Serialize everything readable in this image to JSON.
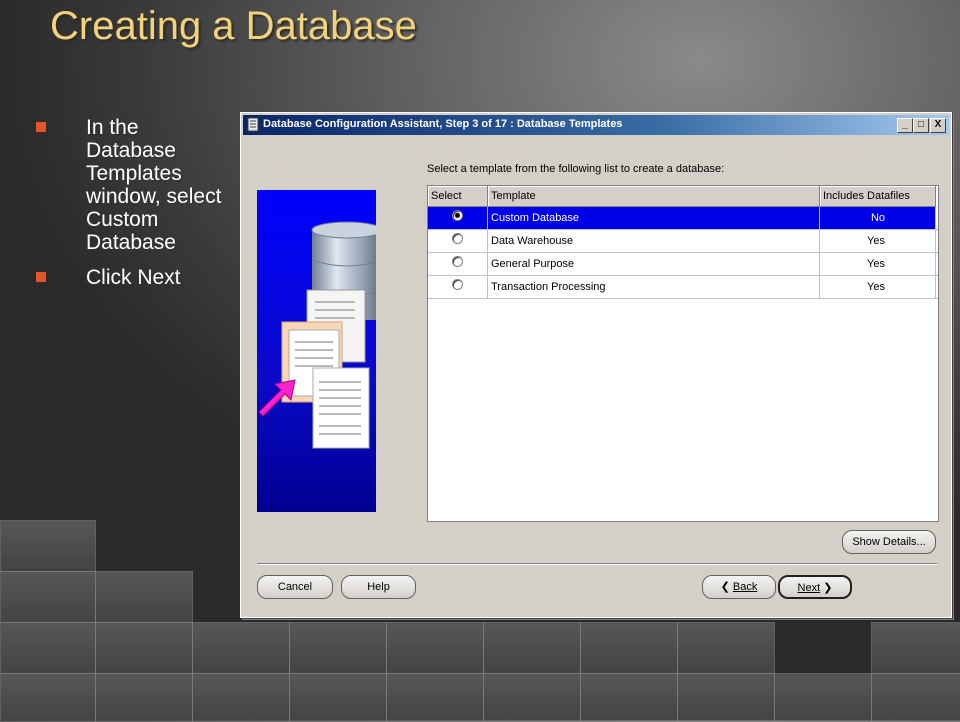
{
  "slide": {
    "title": "Creating a Database",
    "bullets": [
      "In the Database Templates window, select Custom Database",
      "Click Next"
    ]
  },
  "dialog": {
    "title": "Database Configuration Assistant, Step 3 of 17 : Database Templates",
    "window_buttons": [
      "_",
      "□",
      "X"
    ],
    "instruction": "Select a template from the following list to create a database:",
    "columns": [
      "Select",
      "Template",
      "Includes Datafiles"
    ],
    "rows": [
      {
        "template": "Custom Database",
        "includes": "No",
        "selected": true
      },
      {
        "template": "Data Warehouse",
        "includes": "Yes",
        "selected": false
      },
      {
        "template": "General Purpose",
        "includes": "Yes",
        "selected": false
      },
      {
        "template": "Transaction Processing",
        "includes": "Yes",
        "selected": false
      }
    ],
    "buttons": {
      "show_details": "Show Details...",
      "cancel": "Cancel",
      "help": "Help",
      "back": "Back",
      "next": "Next"
    },
    "colors": {
      "selection": "#0000e8",
      "banner": "#0000ff",
      "title_accent": "#f3d27a",
      "bullet": "#e8542a"
    }
  }
}
